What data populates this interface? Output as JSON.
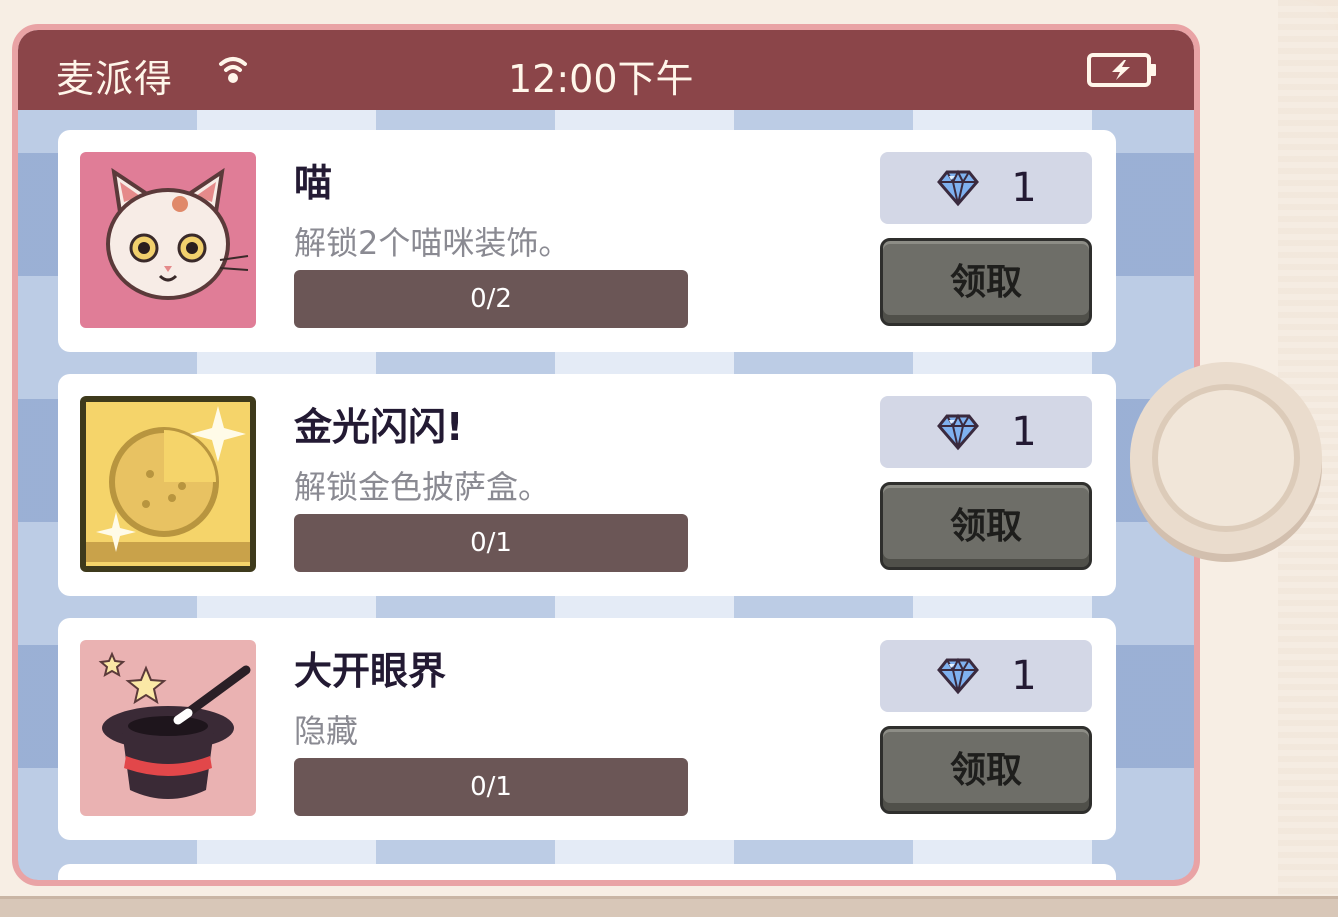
{
  "status_bar": {
    "carrier": "麦派得",
    "time": "12:00下午",
    "icons": [
      "wifi-icon",
      "battery-charging-icon"
    ]
  },
  "achievements": [
    {
      "title": "喵",
      "description": "解锁2个喵咪装饰。",
      "progress": "0/2",
      "progress_fraction": 0,
      "reward_count": "1",
      "claim_label": "领取",
      "icon": "cat-icon"
    },
    {
      "title": "金光闪闪!",
      "description": "解锁金色披萨盒。",
      "progress": "0/1",
      "progress_fraction": 0,
      "reward_count": "1",
      "claim_label": "领取",
      "icon": "golden-pizza-box-icon"
    },
    {
      "title": "大开眼界",
      "description": "隐藏",
      "progress": "0/1",
      "progress_fraction": 0,
      "reward_count": "1",
      "claim_label": "领取",
      "icon": "magic-hat-icon"
    }
  ],
  "colors": {
    "status_bar": "#8b4549",
    "frame": "#e9a3a5",
    "progress_bar": "#6b5656",
    "claim_button": "#6e6e68",
    "reward_bg": "#d3d7e6"
  }
}
